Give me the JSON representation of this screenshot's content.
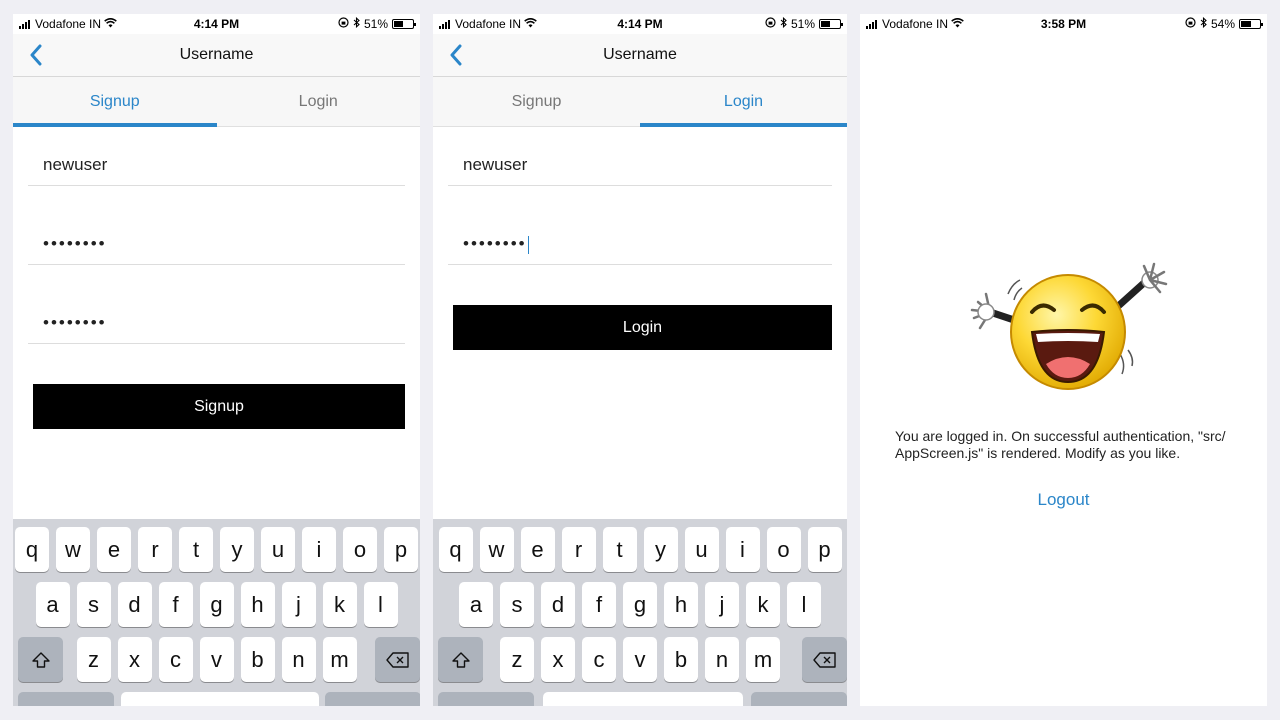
{
  "screens": {
    "signup": {
      "status": {
        "carrier": "Vodafone IN",
        "time": "4:14 PM",
        "battery": "51%",
        "battery_level": 0.51
      },
      "nav_title": "Username",
      "tabs": [
        {
          "label": "Signup",
          "active": true
        },
        {
          "label": "Login",
          "active": false
        }
      ],
      "username_value": "newuser",
      "password_value": "••••••••",
      "confirm_password_value": "••••••••",
      "button_label": "Signup"
    },
    "login": {
      "status": {
        "carrier": "Vodafone IN",
        "time": "4:14 PM",
        "battery": "51%",
        "battery_level": 0.51
      },
      "nav_title": "Username",
      "tabs": [
        {
          "label": "Signup",
          "active": false
        },
        {
          "label": "Login",
          "active": true
        }
      ],
      "username_value": "newuser",
      "password_value": "••••••••",
      "button_label": "Login"
    },
    "app": {
      "status": {
        "carrier": "Vodafone IN",
        "time": "3:58 PM",
        "battery": "54%",
        "battery_level": 0.54
      },
      "message_line1": "You are logged in. On successful authentication, \"src/",
      "message_line2": "AppScreen.js\" is rendered. Modify as you like.",
      "logout_label": "Logout",
      "illustration": "laughing-emoji-arms-raised"
    }
  },
  "keyboard": {
    "row1": [
      "q",
      "w",
      "e",
      "r",
      "t",
      "y",
      "u",
      "i",
      "o",
      "p"
    ],
    "row2": [
      "a",
      "s",
      "d",
      "f",
      "g",
      "h",
      "j",
      "k",
      "l"
    ],
    "row3": [
      "z",
      "x",
      "c",
      "v",
      "b",
      "n",
      "m"
    ],
    "shift_icon": "shift-arrow-icon",
    "delete_icon": "backspace-icon"
  },
  "colors": {
    "accent": "#2b86c9",
    "button": "#000000",
    "keyboard_bg": "#d1d3d9"
  }
}
